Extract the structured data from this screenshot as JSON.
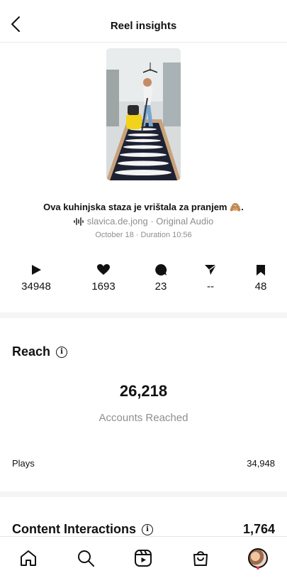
{
  "header": {
    "title": "Reel insights",
    "back_icon": "chevron-left-icon"
  },
  "reel": {
    "caption": "Ova kuhinjska staza je vrištala za pranjem 🙈.",
    "audio_icon": "audio-waveform-icon",
    "audio": "slavica.de.jong · Original Audio",
    "meta": "October 18 · Duration 10:56"
  },
  "stats": [
    {
      "icon": "play-icon",
      "value": "34948"
    },
    {
      "icon": "heart-icon",
      "value": "1693"
    },
    {
      "icon": "comment-icon",
      "value": "23"
    },
    {
      "icon": "share-icon",
      "value": "--"
    },
    {
      "icon": "bookmark-icon",
      "value": "48"
    }
  ],
  "reach": {
    "title": "Reach",
    "number": "26,218",
    "label": "Accounts Reached",
    "plays_label": "Plays",
    "plays_value": "34,948"
  },
  "content_interactions": {
    "label": "Content Interactions",
    "value": "1,764"
  },
  "tabbar": {
    "items": [
      "home-icon",
      "search-icon",
      "reels-icon",
      "shop-icon",
      "profile-avatar"
    ]
  },
  "colors": {
    "text": "#111111",
    "secondary": "#8e8e8e",
    "separator": "#f5f5f5",
    "notification": "#ff3040"
  }
}
